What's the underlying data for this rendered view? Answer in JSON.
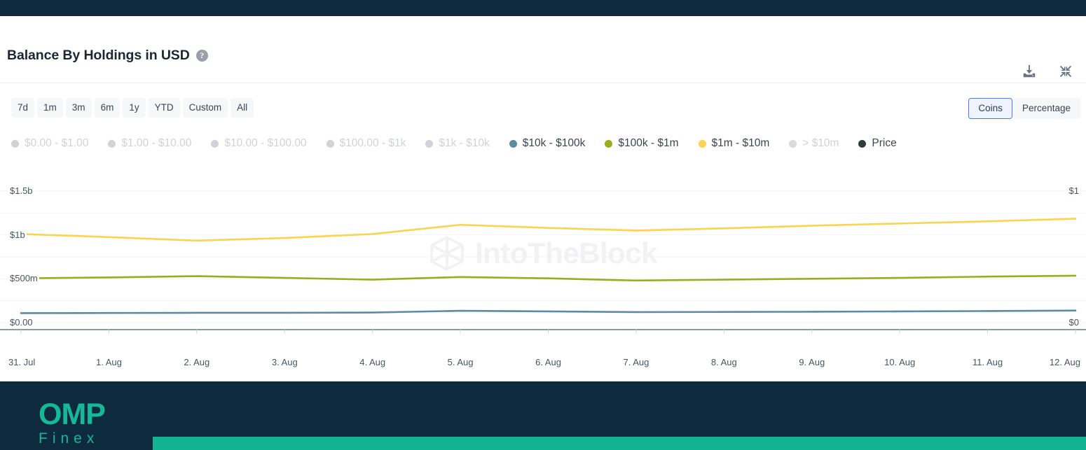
{
  "header": {
    "title": "Balance By Holdings in USD",
    "help_icon": "question-mark-icon",
    "download_icon": "download-icon",
    "collapse_icon": "collapse-icon"
  },
  "controls": {
    "ranges": [
      "7d",
      "1m",
      "3m",
      "6m",
      "1y",
      "YTD",
      "Custom",
      "All"
    ],
    "units": [
      {
        "label": "Coins",
        "active": true
      },
      {
        "label": "Percentage",
        "active": false
      }
    ]
  },
  "legend": [
    {
      "label": "$0.00 - $1.00",
      "color": "#cfd2d6",
      "enabled": false
    },
    {
      "label": "$1.00 - $10.00",
      "color": "#cfd2d6",
      "enabled": false
    },
    {
      "label": "$10.00 - $100.00",
      "color": "#cfd2d6",
      "enabled": false
    },
    {
      "label": "$100.00 - $1k",
      "color": "#cfd2d6",
      "enabled": false
    },
    {
      "label": "$1k - $10k",
      "color": "#cfd2d6",
      "enabled": false
    },
    {
      "label": "$10k - $100k",
      "color": "#5b8ca4",
      "enabled": true
    },
    {
      "label": "$100k - $1m",
      "color": "#9aad1c",
      "enabled": true
    },
    {
      "label": "$1m - $10m",
      "color": "#fbd councils",
      "enabled": true
    },
    {
      "label": "> $10m",
      "color": "#d8dade",
      "enabled": false
    },
    {
      "label": "Price",
      "color": "#2f3b44",
      "enabled": true
    }
  ],
  "footer": {
    "logo_primary": "OMP",
    "logo_secondary": "Finex"
  },
  "watermark": {
    "text": "IntoTheBlock",
    "mark": "intotheblock-logo-icon"
  },
  "chart_data": {
    "type": "line",
    "title": "Balance By Holdings in USD",
    "xlabel": "",
    "ylabel": "",
    "grid": true,
    "legend_position": "top",
    "x": [
      "31. Jul",
      "1. Aug",
      "2. Aug",
      "3. Aug",
      "4. Aug",
      "5. Aug",
      "6. Aug",
      "7. Aug",
      "8. Aug",
      "9. Aug",
      "10. Aug",
      "11. Aug",
      "12. Aug"
    ],
    "y_axis_left": {
      "ticks": [
        "$0.00",
        "$500m",
        "$1b",
        "$1.5b"
      ],
      "tick_values": [
        0,
        500000000,
        1000000000,
        1500000000
      ],
      "ylim": [
        0,
        1500000000
      ]
    },
    "y_axis_right": {
      "ticks": [
        "$0",
        "$1"
      ],
      "tick_values": [
        0,
        1
      ],
      "ylim": [
        0,
        1
      ]
    },
    "series": [
      {
        "name": "$1m - $10m",
        "color": "#fbd34d",
        "axis": "left",
        "values": [
          1010000000,
          975000000,
          935000000,
          965000000,
          1010000000,
          1115000000,
          1080000000,
          1050000000,
          1075000000,
          1105000000,
          1130000000,
          1155000000,
          1185000000
        ]
      },
      {
        "name": "$100k - $1m",
        "color": "#9aad1c",
        "axis": "left",
        "values": [
          505000000,
          515000000,
          530000000,
          510000000,
          490000000,
          520000000,
          505000000,
          480000000,
          490000000,
          500000000,
          510000000,
          525000000,
          535000000
        ]
      },
      {
        "name": "$10k - $100k",
        "color": "#5b8ca4",
        "axis": "left",
        "values": [
          108000000,
          110000000,
          112000000,
          112000000,
          115000000,
          135000000,
          128000000,
          120000000,
          122000000,
          124000000,
          128000000,
          132000000,
          138000000
        ]
      }
    ]
  }
}
